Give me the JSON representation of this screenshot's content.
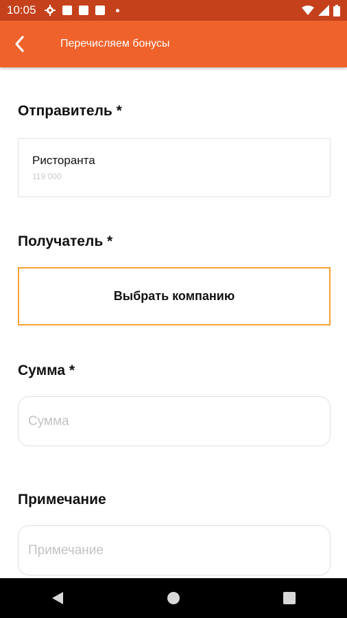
{
  "status_bar": {
    "time": "10:05"
  },
  "app_bar": {
    "title": "Перечисляем бонусы"
  },
  "form": {
    "sender": {
      "label": "Отправитель *",
      "name": "Ристоранта",
      "amount": "119 000"
    },
    "recipient": {
      "label": "Получатель *",
      "button_label": "Выбрать компанию"
    },
    "amount": {
      "label": "Сумма *",
      "placeholder": "Сумма",
      "value": ""
    },
    "note": {
      "label": "Примечание",
      "placeholder": "Примечание",
      "value": ""
    }
  },
  "colors": {
    "app_bar": "#f0622b",
    "status_bar": "#c4411c",
    "accent_border": "#f7a032"
  }
}
